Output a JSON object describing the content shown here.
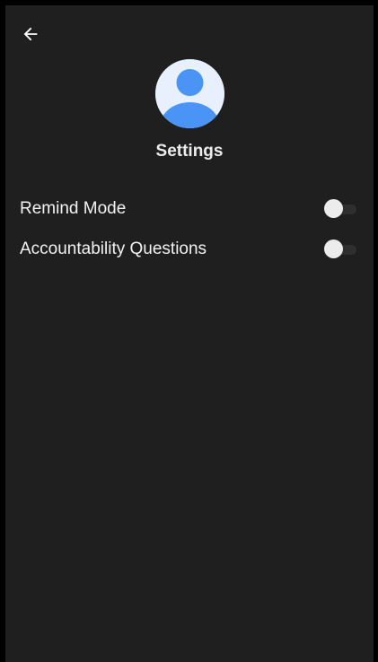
{
  "header": {
    "back_icon": "arrow-left-icon",
    "avatar_icon": "person-avatar-icon",
    "title": "Settings"
  },
  "settings": [
    {
      "label": "Remind Mode",
      "enabled": false
    },
    {
      "label": "Accountability Questions",
      "enabled": false
    }
  ],
  "colors": {
    "background": "#1f1f1f",
    "text": "#ffffff",
    "avatar_background": "#e8f0fe",
    "avatar_figure": "#4a94f5",
    "toggle_thumb": "#ececec",
    "toggle_track": "#2f2f2f"
  }
}
